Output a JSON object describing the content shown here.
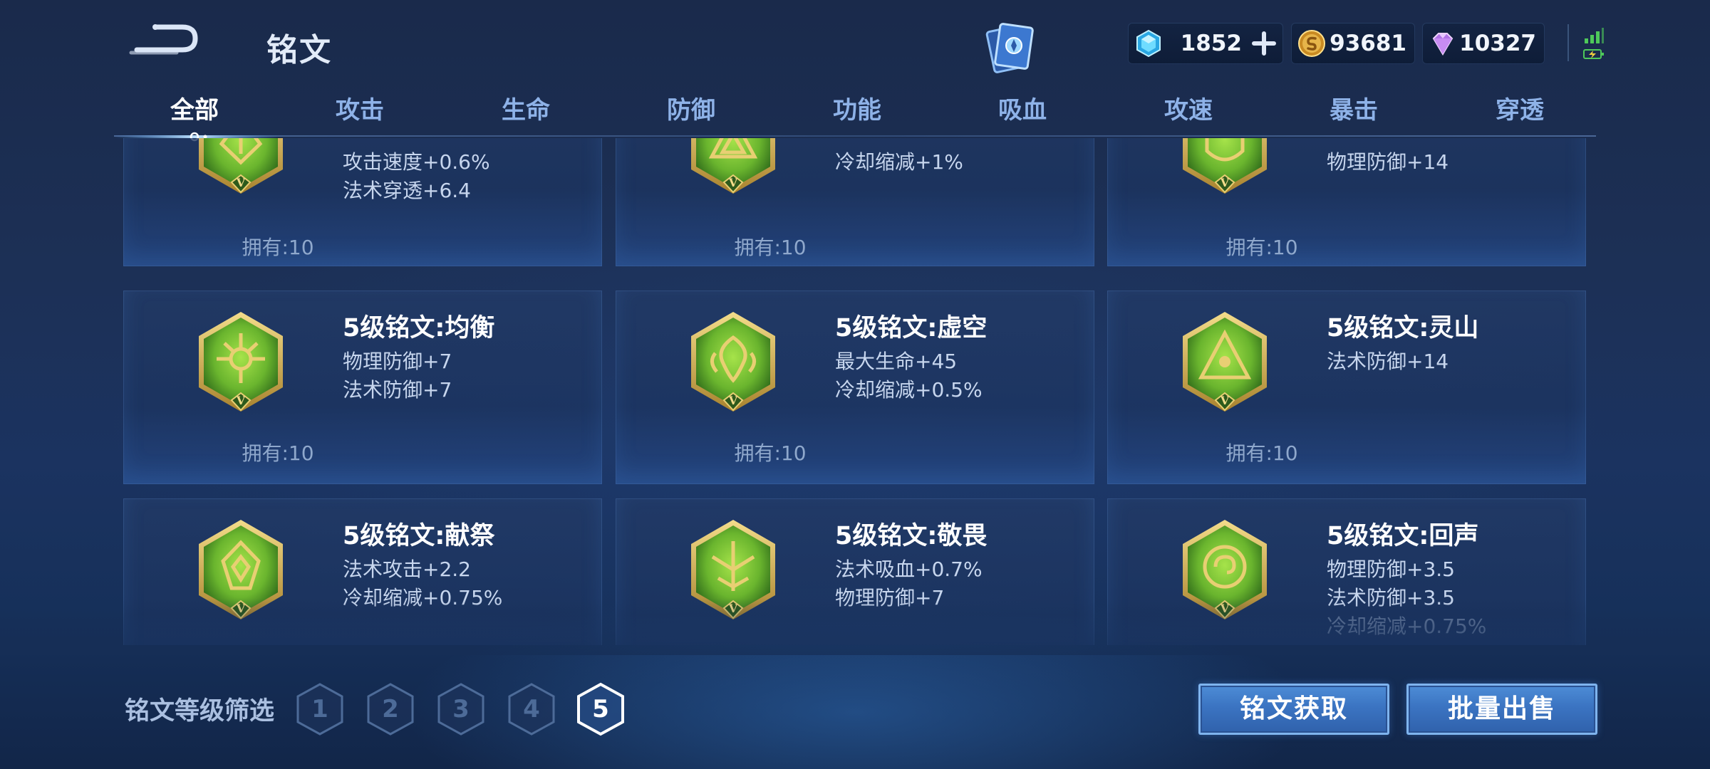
{
  "header": {
    "title": "铭文",
    "currencies": [
      {
        "name": "diamond",
        "value": "1852",
        "icon": "blue-crystal-icon",
        "color": "#39c3f0"
      },
      {
        "name": "gold",
        "value": "93681",
        "icon": "gold-coin-icon",
        "color": "#e7b54a"
      },
      {
        "name": "gem",
        "value": "10327",
        "icon": "purple-gem-icon",
        "color": "#c88cf2"
      }
    ]
  },
  "tabs": [
    "全部",
    "攻击",
    "生命",
    "防御",
    "功能",
    "吸血",
    "攻速",
    "暴击",
    "穿透"
  ],
  "active_tab": "全部",
  "runes": [
    {
      "name": "",
      "attrs": [
        "攻击速度+0.6%",
        "法术穿透+6.4"
      ],
      "owned": "拥有:10"
    },
    {
      "name": "",
      "attrs": [
        "冷却缩减+1%"
      ],
      "owned": "拥有:10"
    },
    {
      "name": "",
      "attrs": [
        "物理防御+14"
      ],
      "owned": "拥有:10"
    },
    {
      "name": "5级铭文:均衡",
      "attrs": [
        "物理防御+7",
        "法术防御+7"
      ],
      "owned": "拥有:10"
    },
    {
      "name": "5级铭文:虚空",
      "attrs": [
        "最大生命+45",
        "冷却缩减+0.5%"
      ],
      "owned": "拥有:10"
    },
    {
      "name": "5级铭文:灵山",
      "attrs": [
        "法术防御+14"
      ],
      "owned": "拥有:10"
    },
    {
      "name": "5级铭文:献祭",
      "attrs": [
        "法术攻击+2.2",
        "冷却缩减+0.75%"
      ],
      "owned": ""
    },
    {
      "name": "5级铭文:敬畏",
      "attrs": [
        "法术吸血+0.7%",
        "物理防御+7"
      ],
      "owned": ""
    },
    {
      "name": "5级铭文:回声",
      "attrs": [
        "物理防御+3.5",
        "法术防御+3.5",
        "冷却缩减+0.75%"
      ],
      "owned": ""
    }
  ],
  "footer": {
    "filter_label": "铭文等级筛选",
    "levels": [
      "1",
      "2",
      "3",
      "4",
      "5"
    ],
    "active_level": "5",
    "obtain_label": "铭文获取",
    "sell_label": "批量出售"
  },
  "colors": {
    "accent": "#3b74c2",
    "rune_green": "#6ab52e",
    "rune_gold": "#c9a645"
  }
}
